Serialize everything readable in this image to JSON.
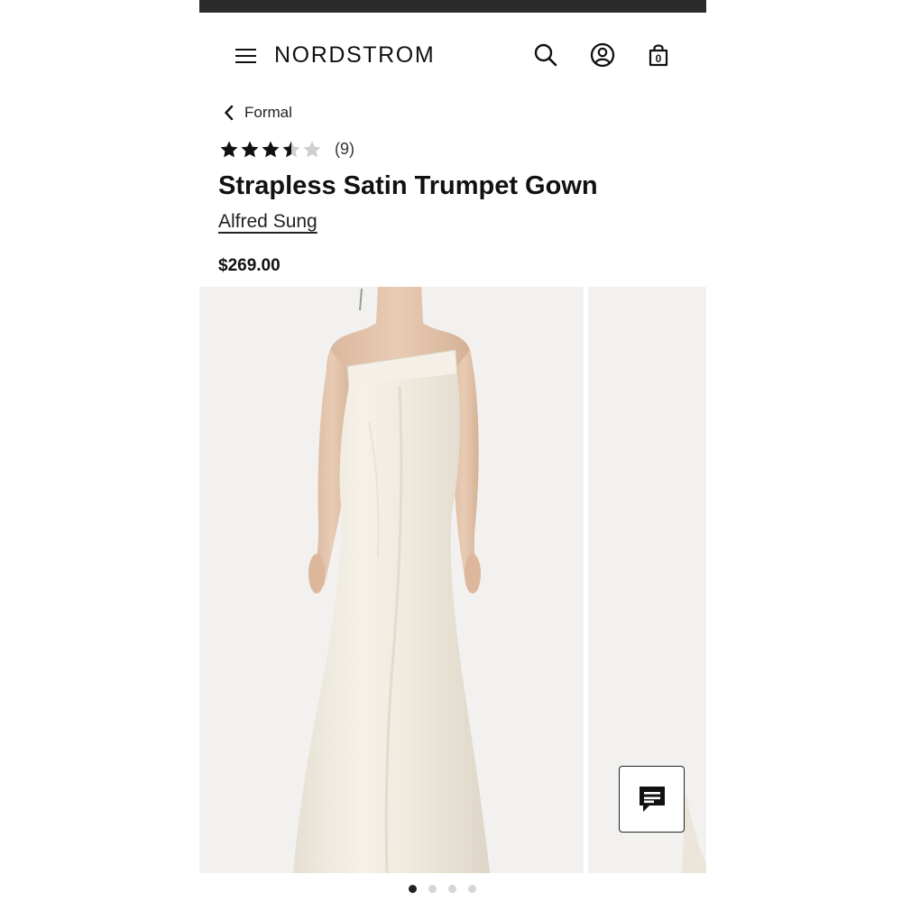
{
  "header": {
    "logo": "NORDSTROM",
    "menu_icon": "hamburger-menu-icon",
    "search_icon": "search-icon",
    "account_icon": "account-icon",
    "bag_icon": "shopping-bag-icon",
    "bag_count": "0"
  },
  "breadcrumb": {
    "label": "Formal",
    "icon": "chevron-left-icon"
  },
  "product": {
    "rating": 3.5,
    "rating_max": 5,
    "review_count": "(9)",
    "title": "Strapless Satin Trumpet Gown",
    "brand": "Alfred Sung",
    "price": "$269.00"
  },
  "gallery": {
    "image_count": 4,
    "active_index": 0
  },
  "chat": {
    "icon": "chat-icon"
  },
  "colors": {
    "top_bar": "#2b2b2b",
    "text": "#111111",
    "star_filled": "#111111",
    "star_empty": "#cfcfcf",
    "image_bg": "#f2f1ef"
  }
}
